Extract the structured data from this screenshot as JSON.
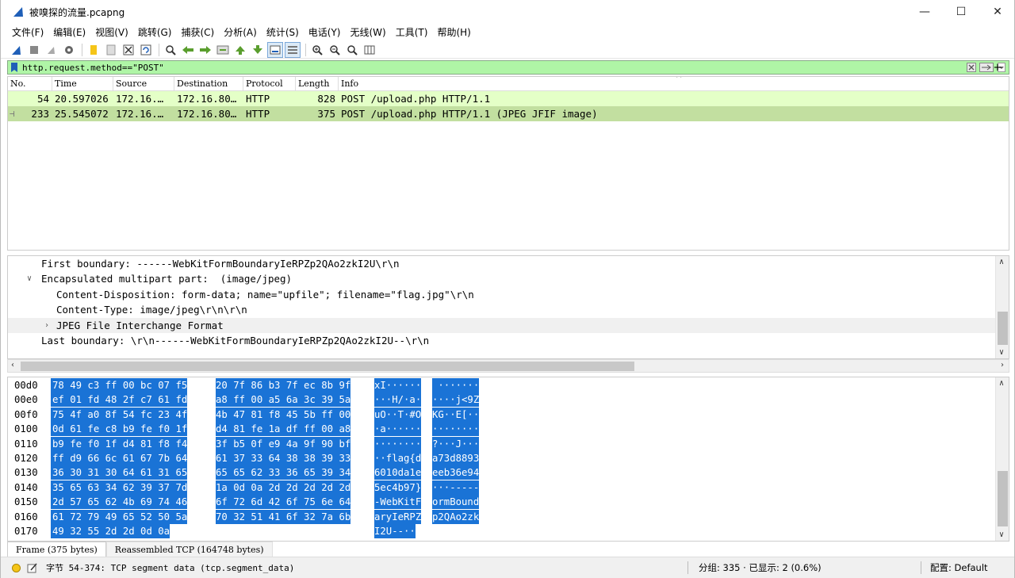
{
  "window": {
    "title": "被嗅探的流量.pcapng",
    "min": "—",
    "max": "☐",
    "close": "✕"
  },
  "menu": [
    "文件(F)",
    "编辑(E)",
    "视图(V)",
    "跳转(G)",
    "捕获(C)",
    "分析(A)",
    "统计(S)",
    "电话(Y)",
    "无线(W)",
    "工具(T)",
    "帮助(H)"
  ],
  "filter": {
    "value": "http.request.method==\"POST\"",
    "plus": "+"
  },
  "packet_list": {
    "columns": [
      "No.",
      "Time",
      "Source",
      "Destination",
      "Protocol",
      "Length",
      "Info"
    ],
    "rows": [
      {
        "no": "54",
        "time": "20.597026",
        "src": "172.16.…",
        "dst": "172.16.80…",
        "proto": "HTTP",
        "len": "828",
        "info": "POST /upload.php HTTP/1.1"
      },
      {
        "no": "233",
        "time": "25.545072",
        "src": "172.16.…",
        "dst": "172.16.80…",
        "proto": "HTTP",
        "len": "375",
        "info": "POST /upload.php HTTP/1.1  (JPEG JFIF image)"
      }
    ]
  },
  "details": [
    "First boundary: ------WebKitFormBoundaryIeRPZp2QAo2zkI2U\\r\\n",
    "Encapsulated multipart part:  (image/jpeg)",
    "Content-Disposition: form-data; name=\"upfile\"; filename=\"flag.jpg\"\\r\\n",
    "Content-Type: image/jpeg\\r\\n\\r\\n",
    "JPEG File Interchange Format",
    "Last boundary: \\r\\n------WebKitFormBoundaryIeRPZp2QAo2zkI2U--\\r\\n"
  ],
  "bytes": [
    {
      "off": "00d0",
      "h1": "78 49 c3 ff 00 bc 07 f5",
      "h2": "20 7f 86 b3 7f ec 8b 9f",
      "a1": "xI······",
      "a2": " ·······"
    },
    {
      "off": "00e0",
      "h1": "ef 01 fd 48 2f c7 61 fd",
      "h2": "a8 ff 00 a5 6a 3c 39 5a",
      "a1": "···H/·a·",
      "a2": "····j<9Z"
    },
    {
      "off": "00f0",
      "h1": "75 4f a0 8f 54 fc 23 4f",
      "h2": "4b 47 81 f8 45 5b ff 00",
      "a1": "uO··T·#O",
      "a2": "KG··E[··"
    },
    {
      "off": "0100",
      "h1": "0d 61 fe c8 b9 fe f0 1f",
      "h2": "d4 81 fe 1a df ff 00 a8",
      "a1": "·a······",
      "a2": "········"
    },
    {
      "off": "0110",
      "h1": "b9 fe f0 1f d4 81 f8 f4",
      "h2": "3f b5 0f e9 4a 9f 90 bf",
      "a1": "········",
      "a2": "?···J···"
    },
    {
      "off": "0120",
      "h1": "ff d9 66 6c 61 67 7b 64",
      "h2": "61 37 33 64 38 38 39 33",
      "a1": "··flag{d",
      "a2": "a73d8893"
    },
    {
      "off": "0130",
      "h1": "36 30 31 30 64 61 31 65",
      "h2": "65 65 62 33 36 65 39 34",
      "a1": "6010da1e",
      "a2": "eeb36e94"
    },
    {
      "off": "0140",
      "h1": "35 65 63 34 62 39 37 7d",
      "h2": "1a 0d 0a 2d 2d 2d 2d 2d",
      "a1": "5ec4b97}",
      "a2": "···-----"
    },
    {
      "off": "0150",
      "h1": "2d 57 65 62 4b 69 74 46",
      "h2": "6f 72 6d 42 6f 75 6e 64",
      "a1": "-WebKitF",
      "a2": "ormBound"
    },
    {
      "off": "0160",
      "h1": "61 72 79 49 65 52 50 5a",
      "h2": "70 32 51 41 6f 32 7a 6b",
      "a1": "aryIeRPZ",
      "a2": "p2QAo2zk"
    },
    {
      "off": "0170",
      "h1": "49 32 55 2d 2d 0d 0a",
      "h2": "",
      "a1": "I2U--··",
      "a2": ""
    }
  ],
  "byte_tabs": [
    "Frame (375 bytes)",
    "Reassembled TCP (164748 bytes)"
  ],
  "status": {
    "text": "字节 54-374: TCP segment data (tcp.segment_data)",
    "packets": "分组: 335 · 已显示: 2 (0.6%)",
    "profile": "配置: Default"
  },
  "colors": {
    "filter_bg": "#aff5a6",
    "row1": "#e4ffc7",
    "row2": "#c2dfa0",
    "select": "#1a73d6"
  }
}
